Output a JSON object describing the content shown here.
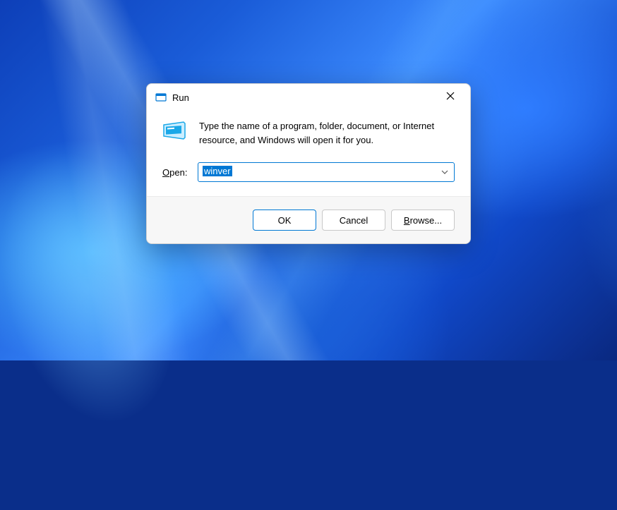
{
  "dialog": {
    "title": "Run",
    "description": "Type the name of a program, folder, document, or Internet resource, and Windows will open it for you.",
    "input_label_prefix": "O",
    "input_label_rest": "pen:",
    "input_value": "winver",
    "buttons": {
      "ok": "OK",
      "cancel": "Cancel",
      "browse_prefix": "B",
      "browse_rest": "rowse..."
    }
  }
}
